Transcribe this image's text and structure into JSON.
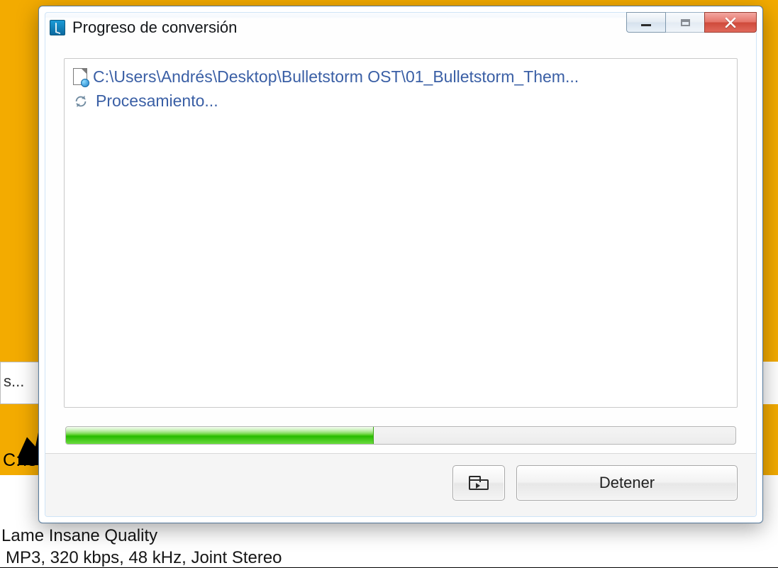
{
  "background": {
    "truncated_bar_text": "s...",
    "path_prefix": "C:\\U",
    "quality_line": "Lame Insane Quality",
    "format_line": "MP3, 320 kbps, 48 kHz, Joint Stereo"
  },
  "dialog": {
    "title": "Progreso de conversión",
    "file_path": "C:\\Users\\Andrés\\Desktop\\Bulletstorm OST\\01_Bulletstorm_Them...",
    "status_text": "Procesamiento...",
    "progress_percent": 46,
    "buttons": {
      "open_folder_icon": "folder-open",
      "stop_label": "Detener"
    },
    "window_controls": {
      "minimize": "minimize",
      "maximize": "maximize",
      "close": "close"
    }
  }
}
